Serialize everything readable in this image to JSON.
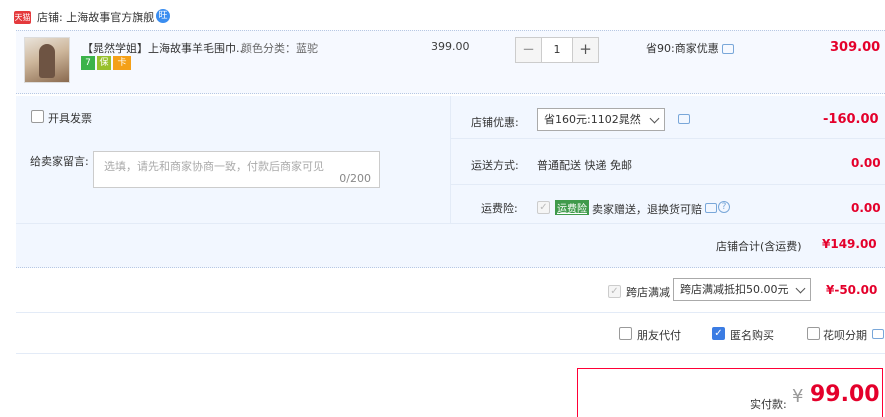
{
  "shop": {
    "tag": "天猫",
    "label": "店铺: 上海故事官方旗舰",
    "ww": "旺"
  },
  "item": {
    "title": "【晁然学姐】上海故事羊毛围巾...",
    "sku": "颜色分类：蓝驼",
    "price": "399.00",
    "quantity": "1",
    "minus": "−",
    "plus": "+",
    "promo": "省90:商家优惠",
    "total": "309.00",
    "badges": [
      "7",
      "保",
      "卡"
    ]
  },
  "invoice": {
    "label": "开具发票"
  },
  "message": {
    "label": "给卖家留言:",
    "placeholder": "选填，请先和商家协商一致，付款后商家可见",
    "counter": "0/200"
  },
  "coupon": {
    "label": "店铺优惠:",
    "selected": "省160元:1102晁然",
    "value": "-160.00"
  },
  "delivery": {
    "label": "运送方式:",
    "method": "普通配送 快递 免邮",
    "value": "0.00"
  },
  "insurance": {
    "label": "运费险:",
    "badge": "运费险",
    "text": "卖家赠送，退换货可赔",
    "value": "0.00",
    "help": "?"
  },
  "shop_total": {
    "label": "店铺合计(含运费)",
    "value": "¥149.00"
  },
  "cross_store": {
    "label": "跨店满减",
    "selected": "跨店满减抵扣50.00元",
    "value": "¥-50.00"
  },
  "options": {
    "friend_pay": "朋友代付",
    "anonymous": "匿名购买",
    "installment": "花呗分期"
  },
  "payment": {
    "label": "实付款:",
    "currency": "¥",
    "amount": "99.00"
  },
  "colors": {
    "accent": "#e4002b",
    "blue": "#3b7ce3",
    "panel": "#f2f7ff"
  }
}
